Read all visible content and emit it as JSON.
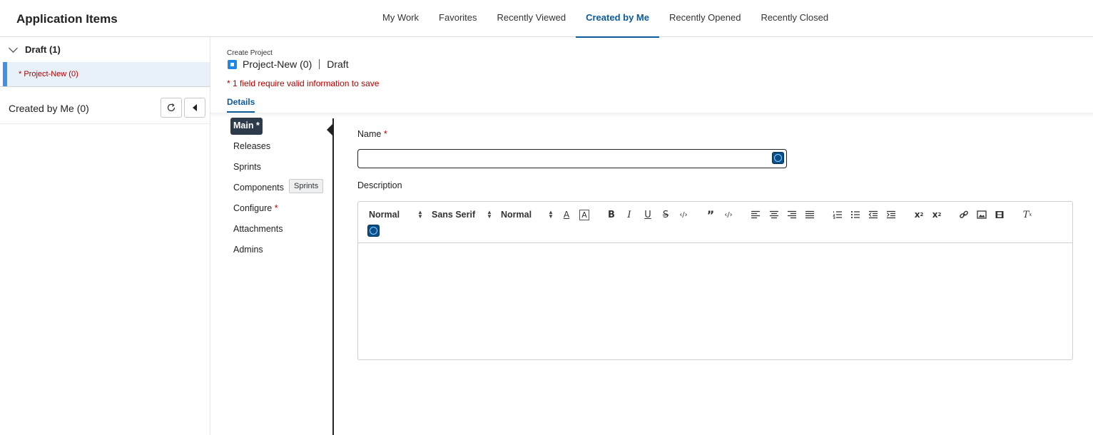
{
  "app": {
    "title": "Application Items"
  },
  "nav": {
    "tabs": [
      {
        "label": "My Work"
      },
      {
        "label": "Favorites"
      },
      {
        "label": "Recently Viewed"
      },
      {
        "label": "Created by Me",
        "active": true
      },
      {
        "label": "Recently Opened"
      },
      {
        "label": "Recently Closed"
      }
    ]
  },
  "sidebar": {
    "group_label": "Draft (1)",
    "draft_item": "* Project-New (0)",
    "created_label": "Created by Me (0)"
  },
  "main": {
    "breadcrumb": "Create Project",
    "project_name": "Project-New (0)",
    "status": "Draft",
    "warning": "* 1 field require valid information to save",
    "details_tab": "Details"
  },
  "sections": {
    "items": [
      {
        "label": "Main",
        "required_mark": "*",
        "active": true
      },
      {
        "label": "Releases"
      },
      {
        "label": "Sprints"
      },
      {
        "label": "Components"
      },
      {
        "label": "Configure",
        "required_mark": "*"
      },
      {
        "label": "Attachments"
      },
      {
        "label": "Admins"
      }
    ],
    "tooltip": "Sprints"
  },
  "form": {
    "name_label": "Name",
    "name_required": "*",
    "name_value": "",
    "description_label": "Description"
  },
  "editor": {
    "header_select": "Normal",
    "font_select": "Sans Serif",
    "size_select": "Normal",
    "tools": [
      "font-color",
      "highlight",
      "bold",
      "italic",
      "underline",
      "strike",
      "inline-code",
      "blockquote",
      "code-block",
      "align-left",
      "align-center",
      "align-right",
      "align-justify",
      "ordered-list",
      "bullet-list",
      "outdent",
      "indent",
      "subscript",
      "superscript",
      "link",
      "image",
      "video",
      "clear-format"
    ]
  },
  "colors": {
    "accent": "#0a5a9c",
    "error": "#b00000",
    "selected_bg": "#e9f1f8",
    "section_active": "#2d3a4a"
  }
}
